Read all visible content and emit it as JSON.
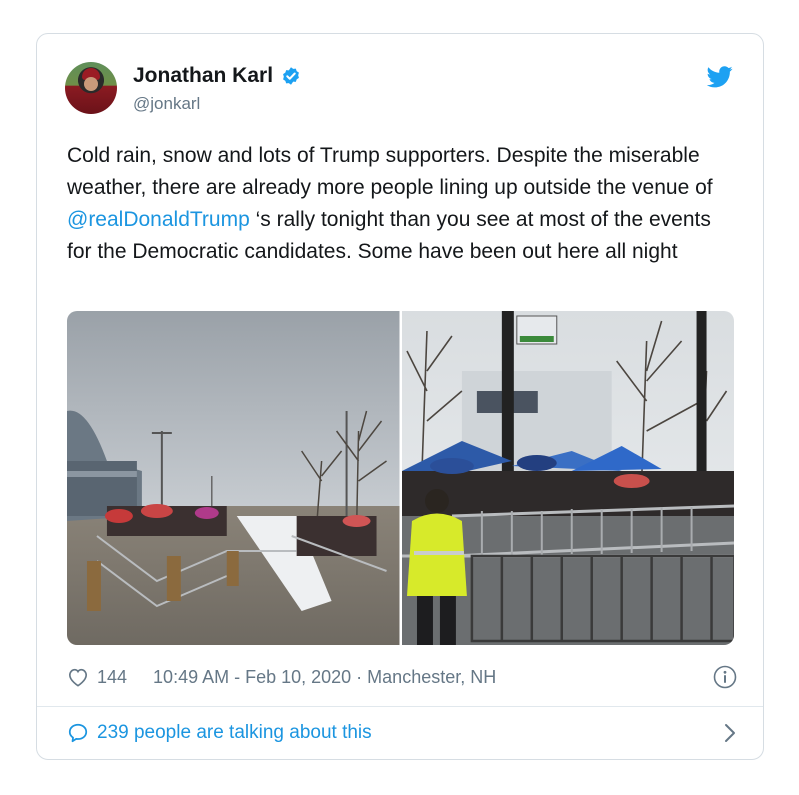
{
  "user": {
    "name": "Jonathan Karl",
    "handle": "@jonkarl"
  },
  "tweet": {
    "text_before": "Cold rain, snow and lots of Trump supporters.  Despite the miserable weather, there are already more people lining up outside the venue of ",
    "mention": "@realDonaldTrump",
    "text_after": " ‘s rally tonight than you see at most of the events for the Democratic candidates. Some have been out here all night"
  },
  "meta": {
    "likes": "144",
    "timestamp": "10:49 AM - Feb 10, 2020 · Manchester, NH"
  },
  "footer": {
    "talking": "239 people are talking about this"
  },
  "icons": {
    "verified": "verified-badge-icon",
    "bird": "twitter-bird-icon",
    "heart": "heart-icon",
    "info": "info-icon",
    "bubble": "speech-bubble-icon",
    "chevron": "chevron-right-icon"
  },
  "colors": {
    "accent": "#1da1f2",
    "link": "#1b95e0",
    "muted": "#657786",
    "border": "#d6dde3"
  }
}
